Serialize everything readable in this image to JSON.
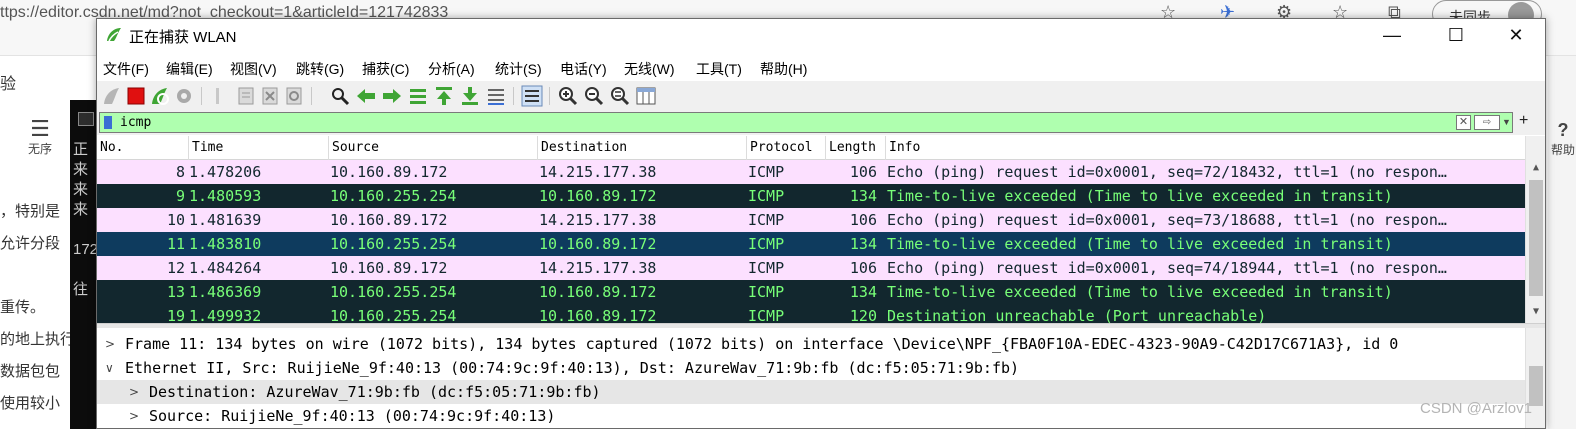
{
  "background": {
    "url": "ttps://editor.csdn.net/md?not_checkout=1&articleId=121742833",
    "sync_label": "未同步",
    "left_title": "验",
    "toc_label": "无序",
    "article_lines": [
      "，特别是",
      "允许分段",
      "",
      "",
      "重传。",
      "的地上执行",
      "数据包包",
      "使用较小"
    ],
    "console_lines": [
      "正",
      "来",
      "来",
      "来",
      "",
      "172",
      "",
      "往"
    ],
    "help_label": "帮助"
  },
  "window": {
    "title": "正在捕获 WLAN",
    "minimize": "—",
    "maximize": "☐",
    "close": "✕"
  },
  "menu": [
    "文件(F)",
    "编辑(E)",
    "视图(V)",
    "跳转(G)",
    "捕获(C)",
    "分析(A)",
    "统计(S)",
    "电话(Y)",
    "无线(W)",
    "工具(T)",
    "帮助(H)"
  ],
  "filter": {
    "value": "icmp",
    "plus": "+"
  },
  "packet_list": {
    "columns": [
      "No.",
      "Time",
      "Source",
      "Destination",
      "Protocol",
      "Length",
      "Info"
    ],
    "rows": [
      {
        "no": "8",
        "time": "1.478206",
        "src": "10.160.89.172",
        "dst": "14.215.177.38",
        "proto": "ICMP",
        "len": "106",
        "info": "Echo (ping) request  id=0x0001, seq=72/18432, ttl=1 (no respon…",
        "bg": "#fce0ff",
        "fg": "#12272e"
      },
      {
        "no": "9",
        "time": "1.480593",
        "src": "10.160.255.254",
        "dst": "10.160.89.172",
        "proto": "ICMP",
        "len": "134",
        "info": "Time-to-live exceeded (Time to live exceeded in transit)",
        "bg": "#12272e",
        "fg": "#78ff78"
      },
      {
        "no": "10",
        "time": "1.481639",
        "src": "10.160.89.172",
        "dst": "14.215.177.38",
        "proto": "ICMP",
        "len": "106",
        "info": "Echo (ping) request  id=0x0001, seq=73/18688, ttl=1 (no respon…",
        "bg": "#fce0ff",
        "fg": "#12272e"
      },
      {
        "no": "11",
        "time": "1.483810",
        "src": "10.160.255.254",
        "dst": "10.160.89.172",
        "proto": "ICMP",
        "len": "134",
        "info": "Time-to-live exceeded (Time to live exceeded in transit)",
        "bg": "#0e3b5e",
        "fg": "#78ff78",
        "selected": true
      },
      {
        "no": "12",
        "time": "1.484264",
        "src": "10.160.89.172",
        "dst": "14.215.177.38",
        "proto": "ICMP",
        "len": "106",
        "info": "Echo (ping) request  id=0x0001, seq=74/18944, ttl=1 (no respon…",
        "bg": "#fce0ff",
        "fg": "#12272e"
      },
      {
        "no": "13",
        "time": "1.486369",
        "src": "10.160.255.254",
        "dst": "10.160.89.172",
        "proto": "ICMP",
        "len": "134",
        "info": "Time-to-live exceeded (Time to live exceeded in transit)",
        "bg": "#12272e",
        "fg": "#78ff78"
      },
      {
        "no": "19",
        "time": "1.499932",
        "src": "10.160.255.254",
        "dst": "10.160.89.172",
        "proto": "ICMP",
        "len": "120",
        "info": "Destination unreachable (Port unreachable)",
        "bg": "#12272e",
        "fg": "#78ff78"
      }
    ]
  },
  "details": [
    {
      "arrow": ">",
      "indent": 0,
      "text": "Frame 11: 134 bytes on wire (1072 bits), 134 bytes captured (1072 bits) on interface \\Device\\NPF_{FBA0F10A-EDEC-4323-90A9-C42D17C671A3}, id 0",
      "highlight": false
    },
    {
      "arrow": "∨",
      "indent": 0,
      "text": "Ethernet II, Src: RuijieNe_9f:40:13 (00:74:9c:9f:40:13), Dst: AzureWav_71:9b:fb (dc:f5:05:71:9b:fb)",
      "highlight": false
    },
    {
      "arrow": ">",
      "indent": 1,
      "text": "Destination: AzureWav_71:9b:fb (dc:f5:05:71:9b:fb)",
      "highlight": true
    },
    {
      "arrow": ">",
      "indent": 1,
      "text": "Source: RuijieNe_9f:40:13 (00:74:9c:9f:40:13)",
      "highlight": false
    }
  ],
  "watermark": "CSDN @Arzlov1",
  "colors": {
    "filter_bg": "#afffaf",
    "icmp_request_bg": "#fce0ff",
    "icmp_error_bg": "#12272e",
    "icmp_error_fg": "#78ff78",
    "selected_bg": "#0e3b5e",
    "detail_highlight": "#e6e6e6"
  },
  "toolbar_icons": [
    "shark-fin-start-icon",
    "stop-capture-icon",
    "restart-capture-icon",
    "capture-options-icon",
    "open-file-icon",
    "save-file-icon",
    "close-file-icon",
    "reload-file-icon",
    "find-packet-icon",
    "go-back-icon",
    "go-forward-icon",
    "go-to-packet-icon",
    "go-first-icon",
    "go-last-icon",
    "autoscroll-icon",
    "colorize-icon",
    "zoom-in-icon",
    "zoom-out-icon",
    "zoom-normal-icon",
    "resize-columns-icon"
  ]
}
